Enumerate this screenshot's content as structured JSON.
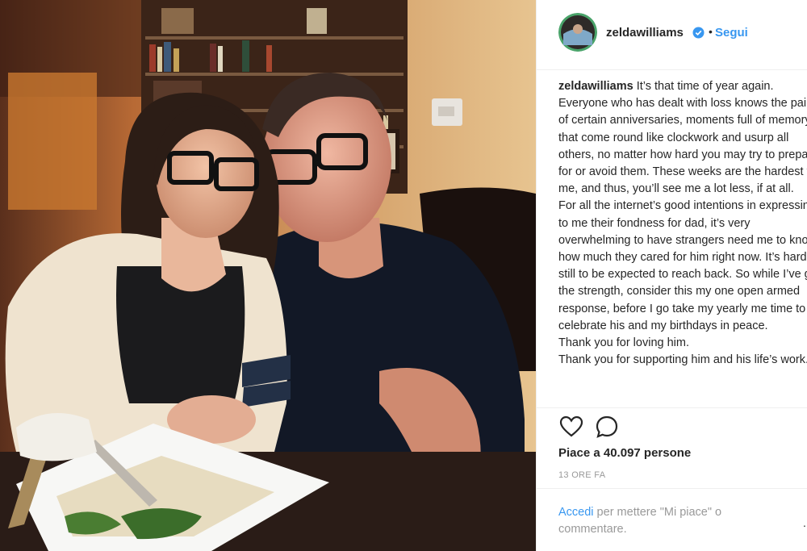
{
  "post": {
    "username": "zeldawilliams",
    "follow_label": "Segui",
    "separator": "•",
    "caption_username": "zeldawilliams",
    "caption_text": " It’s that time of year again. Everyone who has dealt with loss knows the pain of certain anniversaries, moments full of memory that come round like clockwork and usurp all others, no matter how hard you may try to prepare for or avoid them. These weeks are the hardest for me, and thus, you’ll see me a lot less, if at all.\nFor all the internet’s good intentions in expressing to me their fondness for dad, it’s very overwhelming to have strangers need me to know how much they cared for him right now. It’s harder still to be expected to reach back. So while I’ve got the strength, consider this my one open armed response, before I go take my yearly me time to celebrate his and my birthdays in peace.\nThank you for loving him.\nThank you for supporting him and his life’s work.",
    "likes": "Piace a 40.097 persone",
    "timestamp": "13 ORE FA",
    "login_link": "Accedi",
    "login_rest": " per mettere \"Mi piace\" o commentare.",
    "more": "..."
  },
  "icons": {
    "verified": "verified-badge-icon",
    "like": "heart-icon",
    "comment": "comment-bubble-icon"
  },
  "colors": {
    "link": "#3897f0",
    "text": "#262626",
    "muted": "#999999",
    "border": "#efefef"
  }
}
